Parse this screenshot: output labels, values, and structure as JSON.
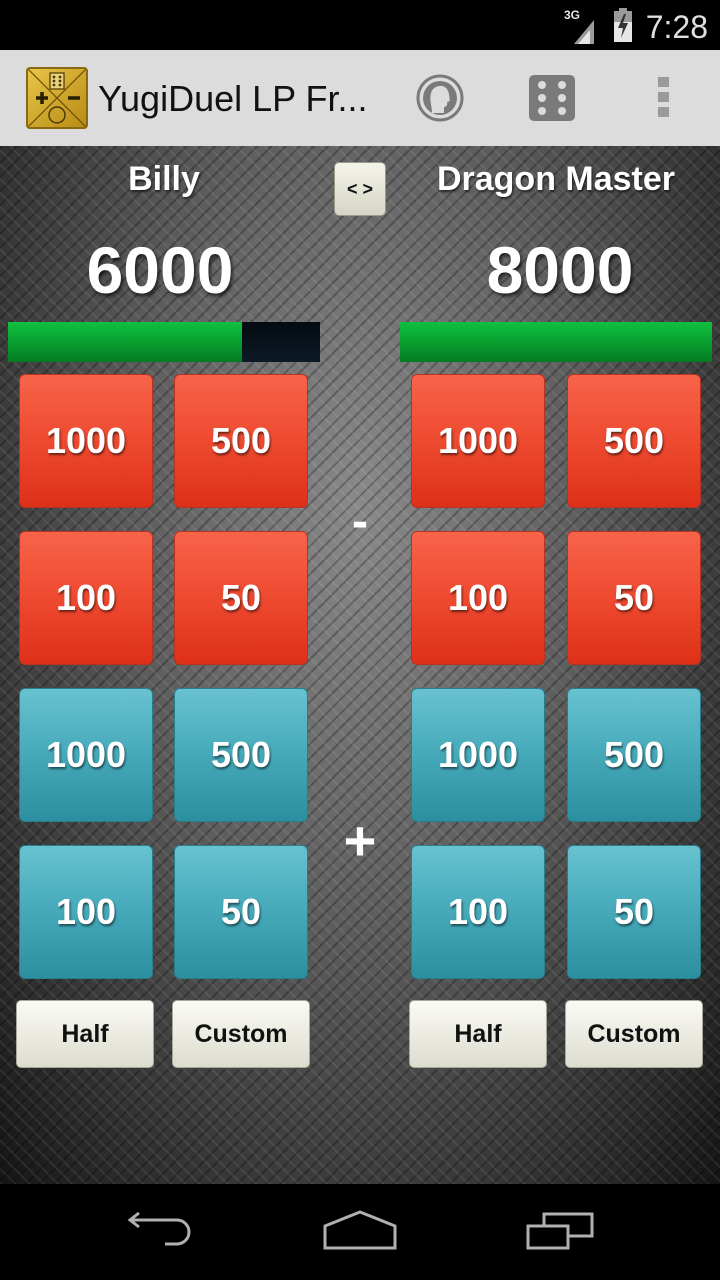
{
  "status_bar": {
    "network": "3G",
    "time": "7:28"
  },
  "action_bar": {
    "title": "YugiDuel LP Fr...",
    "icons": [
      "app-logo-icon",
      "profile-head-icon",
      "dice-icon",
      "overflow-menu-icon"
    ]
  },
  "swap_button": {
    "label": "< >"
  },
  "players": [
    {
      "name": "Billy",
      "life_points": "6000",
      "lp_fraction": 0.75
    },
    {
      "name": "Dragon Master",
      "life_points": "8000",
      "lp_fraction": 1.0
    }
  ],
  "operators": {
    "minus": "-",
    "plus": "+"
  },
  "subtract_buttons": [
    "1000",
    "500",
    "100",
    "50"
  ],
  "add_buttons": [
    "1000",
    "500",
    "100",
    "50"
  ],
  "extra_buttons": {
    "half": "Half",
    "custom": "Custom"
  },
  "colors": {
    "subtract": "#ee4a30",
    "add": "#45a9b9",
    "lp_bar": "#08a030"
  },
  "nav_bar": {
    "icons": [
      "back-icon",
      "home-icon",
      "recents-icon"
    ]
  }
}
